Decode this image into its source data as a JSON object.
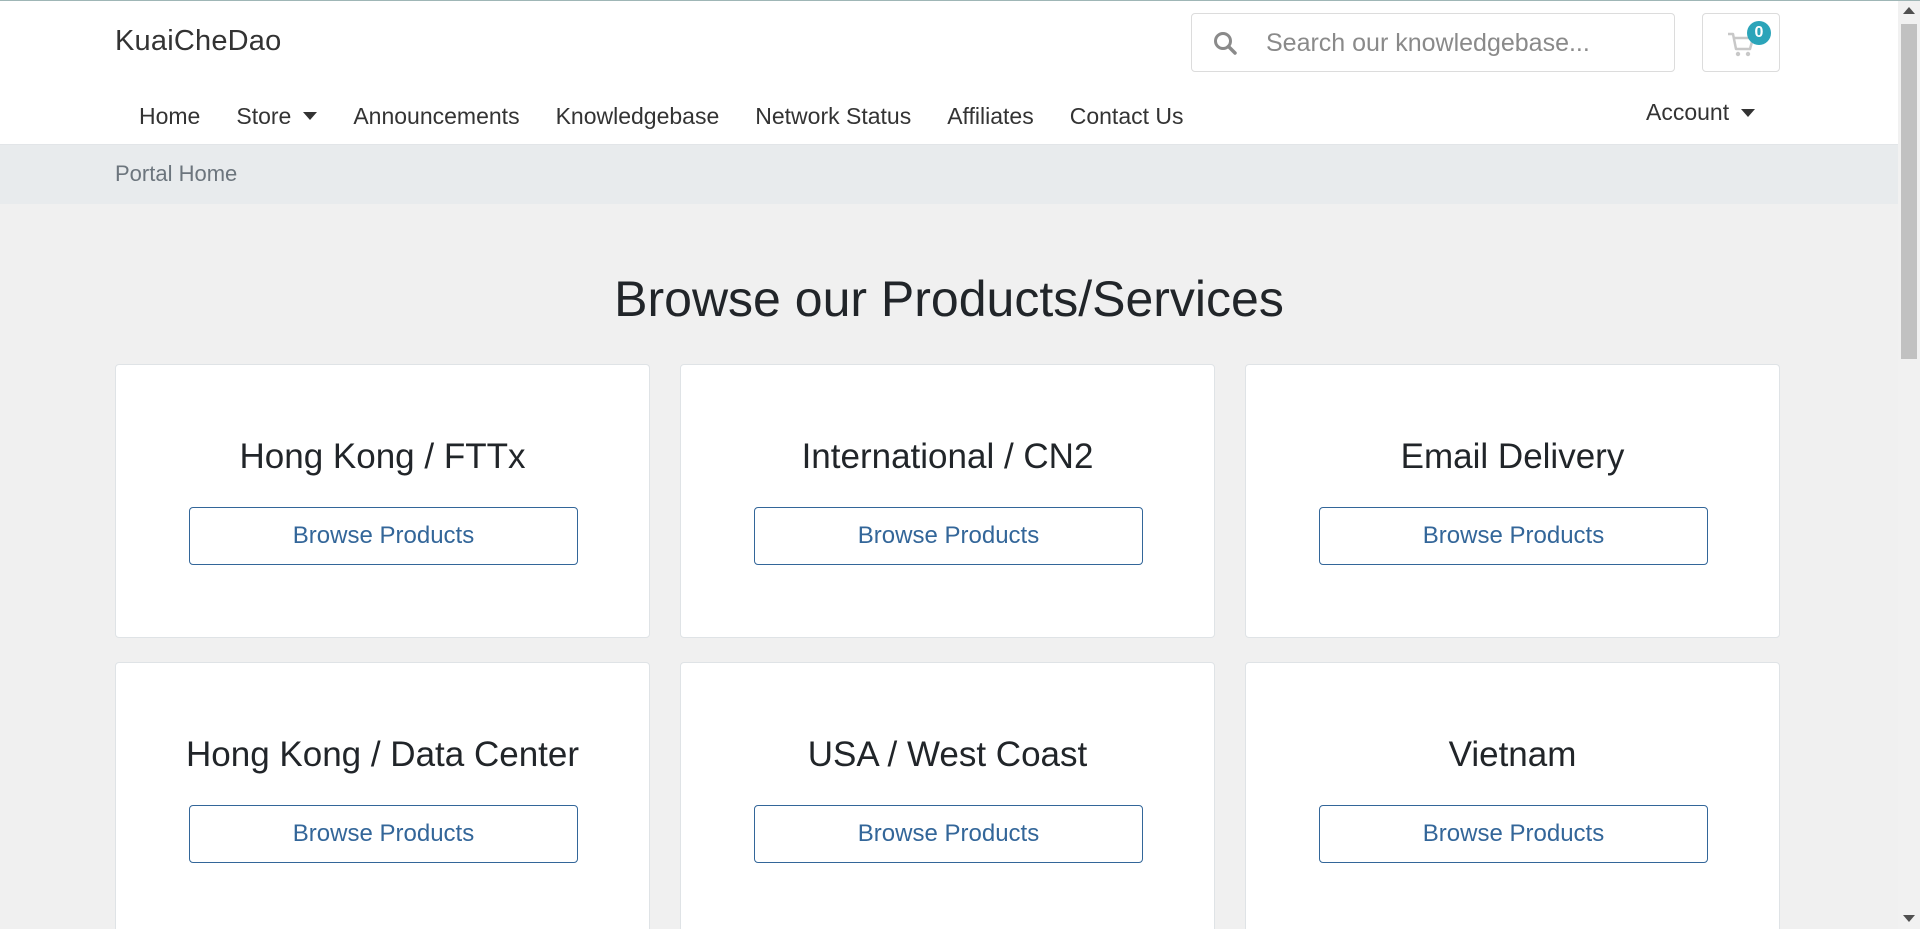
{
  "header": {
    "brand": "KuaiCheDao",
    "search": {
      "placeholder": "Search our knowledgebase..."
    },
    "cart": {
      "count": "0"
    }
  },
  "nav": {
    "items": [
      {
        "label": "Home"
      },
      {
        "label": "Store"
      },
      {
        "label": "Announcements"
      },
      {
        "label": "Knowledgebase"
      },
      {
        "label": "Network Status"
      },
      {
        "label": "Affiliates"
      },
      {
        "label": "Contact Us"
      }
    ],
    "account": "Account"
  },
  "breadcrumb": {
    "current": "Portal Home"
  },
  "main": {
    "title": "Browse our Products/Services",
    "cards": [
      {
        "title": "Hong Kong / FTTx",
        "button": "Browse Products"
      },
      {
        "title": "International / CN2",
        "button": "Browse Products"
      },
      {
        "title": "Email Delivery",
        "button": "Browse Products"
      },
      {
        "title": "Hong Kong / Data Center",
        "button": "Browse Products"
      },
      {
        "title": "USA / West Coast",
        "button": "Browse Products"
      },
      {
        "title": "Vietnam",
        "button": "Browse Products"
      }
    ]
  },
  "colors": {
    "accent": "#336699",
    "badge": "#2ba4b9",
    "breadcrumb_bg": "#e8ebed",
    "page_bg": "#f0f0f0"
  },
  "icons": {
    "search": "search-icon",
    "cart": "cart-icon",
    "caret": "chevron-down-icon"
  }
}
